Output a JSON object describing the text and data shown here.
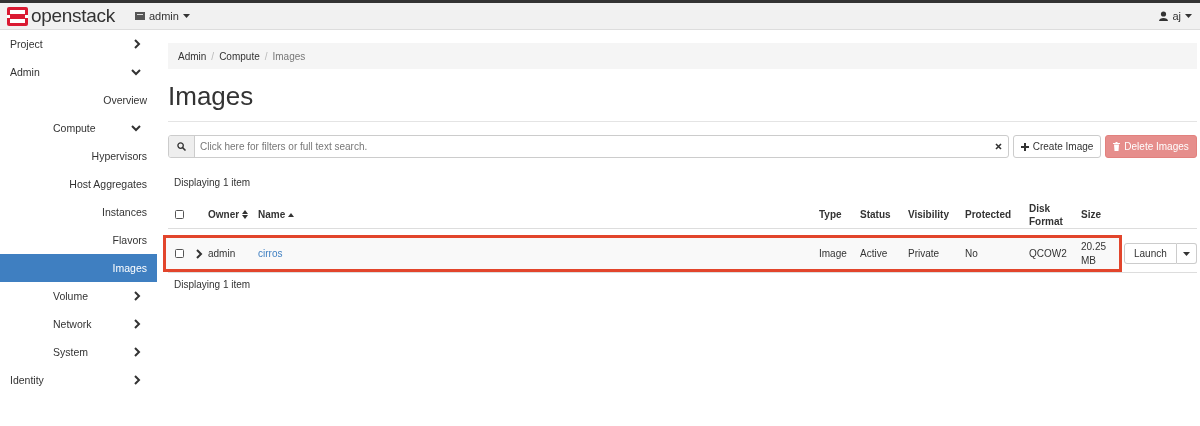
{
  "topbar": {
    "brand": "openstack",
    "project_menu": "admin",
    "user_menu": "aj"
  },
  "sidebar": [
    {
      "label": "Project",
      "kind": "group",
      "expanded": false
    },
    {
      "label": "Admin",
      "kind": "group",
      "expanded": true,
      "children": [
        {
          "label": "Overview",
          "kind": "link",
          "selected": false
        },
        {
          "label": "Compute",
          "kind": "group",
          "expanded": true,
          "children": [
            {
              "label": "Hypervisors",
              "kind": "link",
              "selected": false
            },
            {
              "label": "Host Aggregates",
              "kind": "link",
              "selected": false
            },
            {
              "label": "Instances",
              "kind": "link",
              "selected": false
            },
            {
              "label": "Flavors",
              "kind": "link",
              "selected": false
            },
            {
              "label": "Images",
              "kind": "link",
              "selected": true
            }
          ]
        },
        {
          "label": "Volume",
          "kind": "group",
          "expanded": false
        },
        {
          "label": "Network",
          "kind": "group",
          "expanded": false
        },
        {
          "label": "System",
          "kind": "group",
          "expanded": false
        }
      ]
    },
    {
      "label": "Identity",
      "kind": "group",
      "expanded": false
    }
  ],
  "breadcrumb": {
    "separator": "/",
    "items": [
      "Admin",
      "Compute",
      "Images"
    ]
  },
  "page_title": "Images",
  "search": {
    "placeholder": "Click here for filters or full text search."
  },
  "actions": [
    {
      "label": "Create Image",
      "kind": "plus",
      "disabled": false
    },
    {
      "label": "Delete Images",
      "kind": "trash",
      "disabled": true
    }
  ],
  "table": {
    "summary_top": "Displaying 1 item",
    "select_all": {
      "checked": false
    },
    "columns": [
      {
        "label": "Owner",
        "sortable": true,
        "sorted": false
      },
      {
        "label": "Name",
        "sortable": true,
        "sorted": true,
        "kind": "link"
      },
      {
        "label": "Type",
        "sortable": false
      },
      {
        "label": "Status",
        "sortable": false
      },
      {
        "label": "Visibility",
        "sortable": false
      },
      {
        "label": "Protected",
        "sortable": false
      },
      {
        "label": "Disk Format",
        "sortable": false
      },
      {
        "label": "Size",
        "sortable": false
      }
    ],
    "rows": [
      {
        "checked": false,
        "expanded": false,
        "highlighted": true,
        "cells": [
          "admin",
          "cirros",
          "Image",
          "Active",
          "Private",
          "No",
          "QCOW2",
          "20.25 MB"
        ],
        "action": "Launch"
      }
    ],
    "summary_bottom": "Displaying 1 item"
  }
}
